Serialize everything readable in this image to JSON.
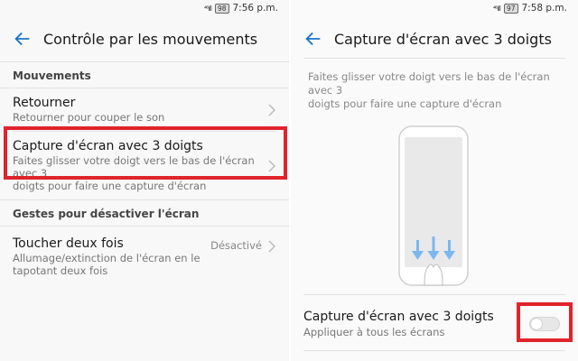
{
  "left": {
    "status": {
      "signal": "⁴⁶ıll",
      "battery": "98",
      "time": "7:56 p.m."
    },
    "title": "Contrôle par les mouvements",
    "sections": [
      {
        "header": "Mouvements"
      },
      {
        "header": "Gestes pour désactiver l'écran"
      }
    ],
    "items": [
      {
        "title": "Retourner",
        "subtitle": "Retourner pour couper le son"
      },
      {
        "title": "Capture d'écran avec 3 doigts",
        "subtitle_line1": "Faites glisser votre doigt vers le bas de l'écran avec 3",
        "subtitle_line2": "doigts pour faire une capture d'écran"
      },
      {
        "title": "Toucher deux fois",
        "subtitle_line1": "Allumage/extinction de l'écran en le",
        "subtitle_line2": "tapotant deux fois",
        "value": "Désactivé"
      }
    ]
  },
  "right": {
    "status": {
      "signal": "⁴⁶ıll",
      "battery": "97",
      "time": "7:58 p.m."
    },
    "title": "Capture d'écran avec 3 doigts",
    "description_line1": "Faites glisser votre doigt vers le bas de l'écran avec 3",
    "description_line2": "doigts pour faire une capture d'écran",
    "toggle": {
      "title": "Capture d'écran avec 3 doigts",
      "subtitle": "Appliquer à tous les écrans",
      "enabled": false
    }
  },
  "colors": {
    "accent": "#1a73c9",
    "highlight": "#e0242c",
    "arrow": "#7ab8f0"
  }
}
